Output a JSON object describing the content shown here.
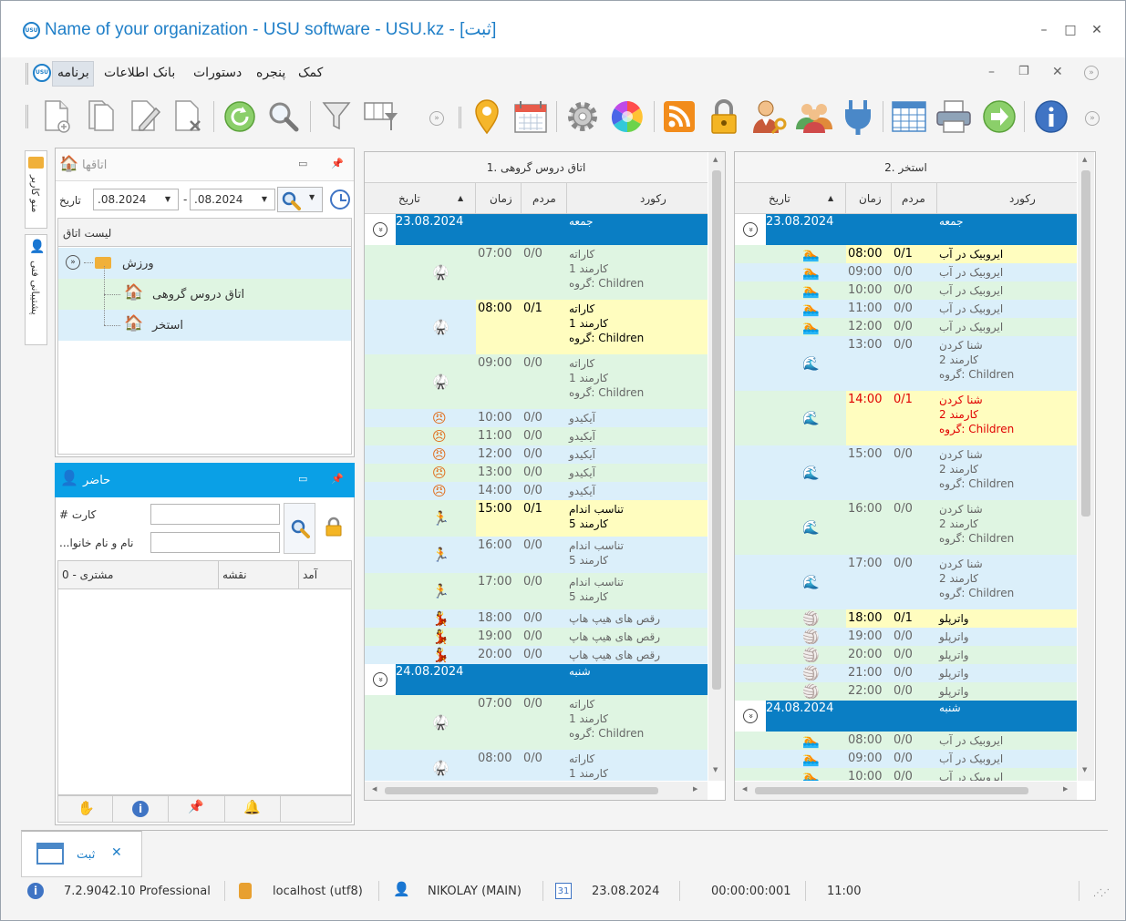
{
  "window": {
    "title": "Name of your organization - USU software - USU.kz - [ثبت]",
    "logo": "USU",
    "controls": [
      "minimize",
      "maximize",
      "close"
    ]
  },
  "menu": {
    "items": [
      "برنامه",
      "بانک اطلاعات",
      "دستورات",
      "پنجره",
      "کمک"
    ]
  },
  "toolbar": {
    "icons": [
      "add-icon",
      "copy-icon",
      "edit-icon",
      "delete-icon",
      "refresh-icon",
      "search-icon",
      "filter-icon",
      "column-settings-icon",
      "location-icon",
      "calendar-icon",
      "gear-icon",
      "color-wheel-icon",
      "rss-icon",
      "lock-icon",
      "user-key-icon",
      "users-icon",
      "plugin-icon",
      "table-icon",
      "printer-icon",
      "next-arrow-icon",
      "info-icon"
    ]
  },
  "side_tabs": [
    "منو کاربر",
    "پشتیبانی فنی"
  ],
  "rooms_panel": {
    "title": "اتاقها",
    "date_label": "تاریخ",
    "date_from": ".08.2024",
    "date_to": ".08.2024",
    "list_header": "لیست اتاق",
    "tree": [
      {
        "label": "ورزش",
        "level": 0
      },
      {
        "label": "اتاق دروس گروهی",
        "level": 1
      },
      {
        "label": "استخر",
        "level": 1
      }
    ]
  },
  "present_panel": {
    "title": "حاضر",
    "card_label": "# کارت",
    "name_label": "...نام و نام خانوا",
    "card_value": "",
    "name_value": "",
    "columns": [
      "آمد",
      "نقشه",
      "مشتری - 0"
    ]
  },
  "schedule_left": {
    "title": "1. اتاق دروس گروهی",
    "columns": [
      "تاریخ",
      "زمان",
      "مردم",
      "رکورد"
    ],
    "rows": [
      {
        "type": "day",
        "date": "23.08.2024",
        "day": "جمعه"
      },
      {
        "type": "item",
        "time": "07:00",
        "people": "0/0",
        "lines": [
          "کاراته",
          "کارمند 1",
          "گروه: Children"
        ],
        "icon": "karate-icon",
        "style": "normal"
      },
      {
        "type": "item",
        "time": "08:00",
        "people": "0/1",
        "lines": [
          "کاراته",
          "کارمند 1",
          "گروه: Children"
        ],
        "icon": "karate-icon",
        "style": "highlight"
      },
      {
        "type": "item",
        "time": "09:00",
        "people": "0/0",
        "lines": [
          "کاراته",
          "کارمند 1",
          "گروه: Children"
        ],
        "icon": "karate-icon",
        "style": "normal"
      },
      {
        "type": "item",
        "time": "10:00",
        "people": "0/0",
        "lines": [
          "آیکیدو"
        ],
        "icon": "aikido-icon",
        "style": "normal"
      },
      {
        "type": "item",
        "time": "11:00",
        "people": "0/0",
        "lines": [
          "آیکیدو"
        ],
        "icon": "aikido-icon",
        "style": "normal"
      },
      {
        "type": "item",
        "time": "12:00",
        "people": "0/0",
        "lines": [
          "آیکیدو"
        ],
        "icon": "aikido-icon",
        "style": "normal"
      },
      {
        "type": "item",
        "time": "13:00",
        "people": "0/0",
        "lines": [
          "آیکیدو"
        ],
        "icon": "aikido-icon",
        "style": "normal"
      },
      {
        "type": "item",
        "time": "14:00",
        "people": "0/0",
        "lines": [
          "آیکیدو"
        ],
        "icon": "aikido-icon",
        "style": "normal"
      },
      {
        "type": "item",
        "time": "15:00",
        "people": "0/1",
        "lines": [
          "تناسب اندام",
          "کارمند 5"
        ],
        "icon": "fitness-icon",
        "style": "highlight"
      },
      {
        "type": "item",
        "time": "16:00",
        "people": "0/0",
        "lines": [
          "تناسب اندام",
          "کارمند 5"
        ],
        "icon": "fitness-icon",
        "style": "normal"
      },
      {
        "type": "item",
        "time": "17:00",
        "people": "0/0",
        "lines": [
          "تناسب اندام",
          "کارمند 5"
        ],
        "icon": "fitness-icon",
        "style": "normal"
      },
      {
        "type": "item",
        "time": "18:00",
        "people": "0/0",
        "lines": [
          "رقص های هیپ هاپ"
        ],
        "icon": "dance-icon",
        "style": "normal"
      },
      {
        "type": "item",
        "time": "19:00",
        "people": "0/0",
        "lines": [
          "رقص های هیپ هاپ"
        ],
        "icon": "dance-icon",
        "style": "normal"
      },
      {
        "type": "item",
        "time": "20:00",
        "people": "0/0",
        "lines": [
          "رقص های هیپ هاپ"
        ],
        "icon": "dance-icon",
        "style": "normal"
      },
      {
        "type": "day",
        "date": "24.08.2024",
        "day": "شنبه"
      },
      {
        "type": "item",
        "time": "07:00",
        "people": "0/0",
        "lines": [
          "کاراته",
          "کارمند 1",
          "گروه: Children"
        ],
        "icon": "karate-icon",
        "style": "normal"
      },
      {
        "type": "item",
        "time": "08:00",
        "people": "0/0",
        "lines": [
          "کاراته",
          "کارمند 1"
        ],
        "icon": "karate-icon",
        "style": "normal"
      }
    ]
  },
  "schedule_right": {
    "title": "2. استخر",
    "columns": [
      "تاریخ",
      "زمان",
      "مردم",
      "رکورد"
    ],
    "rows": [
      {
        "type": "day",
        "date": "23.08.2024",
        "day": "جمعه"
      },
      {
        "type": "item",
        "time": "08:00",
        "people": "0/1",
        "lines": [
          "ایروبیک در آب"
        ],
        "icon": "swim-icon",
        "style": "highlight"
      },
      {
        "type": "item",
        "time": "09:00",
        "people": "0/0",
        "lines": [
          "ایروبیک در آب"
        ],
        "icon": "swim-icon",
        "style": "normal"
      },
      {
        "type": "item",
        "time": "10:00",
        "people": "0/0",
        "lines": [
          "ایروبیک در آب"
        ],
        "icon": "swim-icon",
        "style": "normal"
      },
      {
        "type": "item",
        "time": "11:00",
        "people": "0/0",
        "lines": [
          "ایروبیک در آب"
        ],
        "icon": "swim-icon",
        "style": "normal"
      },
      {
        "type": "item",
        "time": "12:00",
        "people": "0/0",
        "lines": [
          "ایروبیک در آب"
        ],
        "icon": "swim-icon",
        "style": "normal"
      },
      {
        "type": "item",
        "time": "13:00",
        "people": "0/0",
        "lines": [
          "شنا کردن",
          "کارمند 2",
          "گروه: Children"
        ],
        "icon": "wave-icon",
        "style": "normal"
      },
      {
        "type": "item",
        "time": "14:00",
        "people": "0/1",
        "lines": [
          "شنا کردن",
          "کارمند 2",
          "گروه: Children"
        ],
        "icon": "wave-icon",
        "style": "alert"
      },
      {
        "type": "item",
        "time": "15:00",
        "people": "0/0",
        "lines": [
          "شنا کردن",
          "کارمند 2",
          "گروه: Children"
        ],
        "icon": "wave-icon",
        "style": "normal"
      },
      {
        "type": "item",
        "time": "16:00",
        "people": "0/0",
        "lines": [
          "شنا کردن",
          "کارمند 2",
          "گروه: Children"
        ],
        "icon": "wave-icon",
        "style": "normal"
      },
      {
        "type": "item",
        "time": "17:00",
        "people": "0/0",
        "lines": [
          "شنا کردن",
          "کارمند 2",
          "گروه: Children"
        ],
        "icon": "wave-icon",
        "style": "normal"
      },
      {
        "type": "item",
        "time": "18:00",
        "people": "0/1",
        "lines": [
          "واترپلو"
        ],
        "icon": "ball-icon",
        "style": "highlight"
      },
      {
        "type": "item",
        "time": "19:00",
        "people": "0/0",
        "lines": [
          "واترپلو"
        ],
        "icon": "ball-icon",
        "style": "normal"
      },
      {
        "type": "item",
        "time": "20:00",
        "people": "0/0",
        "lines": [
          "واترپلو"
        ],
        "icon": "ball-icon",
        "style": "normal"
      },
      {
        "type": "item",
        "time": "21:00",
        "people": "0/0",
        "lines": [
          "واترپلو"
        ],
        "icon": "ball-icon",
        "style": "normal"
      },
      {
        "type": "item",
        "time": "22:00",
        "people": "0/0",
        "lines": [
          "واترپلو"
        ],
        "icon": "ball-icon",
        "style": "normal"
      },
      {
        "type": "day",
        "date": "24.08.2024",
        "day": "شنبه"
      },
      {
        "type": "item",
        "time": "08:00",
        "people": "0/0",
        "lines": [
          "ایروبیک در آب"
        ],
        "icon": "swim-icon",
        "style": "normal"
      },
      {
        "type": "item",
        "time": "09:00",
        "people": "0/0",
        "lines": [
          "ایروبیک در آب"
        ],
        "icon": "swim-icon",
        "style": "normal"
      },
      {
        "type": "item",
        "time": "10:00",
        "people": "0/0",
        "lines": [
          "ایروبیک در آب"
        ],
        "icon": "swim-icon",
        "style": "normal"
      }
    ]
  },
  "bottom_tab": {
    "label": "ثبت"
  },
  "status": {
    "version": "7.2.9042.10 Professional",
    "server": "localhost (utf8)",
    "user": "NIKOLAY (MAIN)",
    "date": "23.08.2024",
    "timer": "00:00:00:001",
    "time": "11:00",
    "calendar_day": "31"
  },
  "colors": {
    "accent": "#1f7fc8",
    "day_header": "#0a7ec4",
    "panel_header": "#0aa0e6",
    "row_green": "#dff5e2",
    "row_blue": "#dbeffa",
    "row_highlight": "#fffdbf",
    "alert_text": "#e00000"
  }
}
